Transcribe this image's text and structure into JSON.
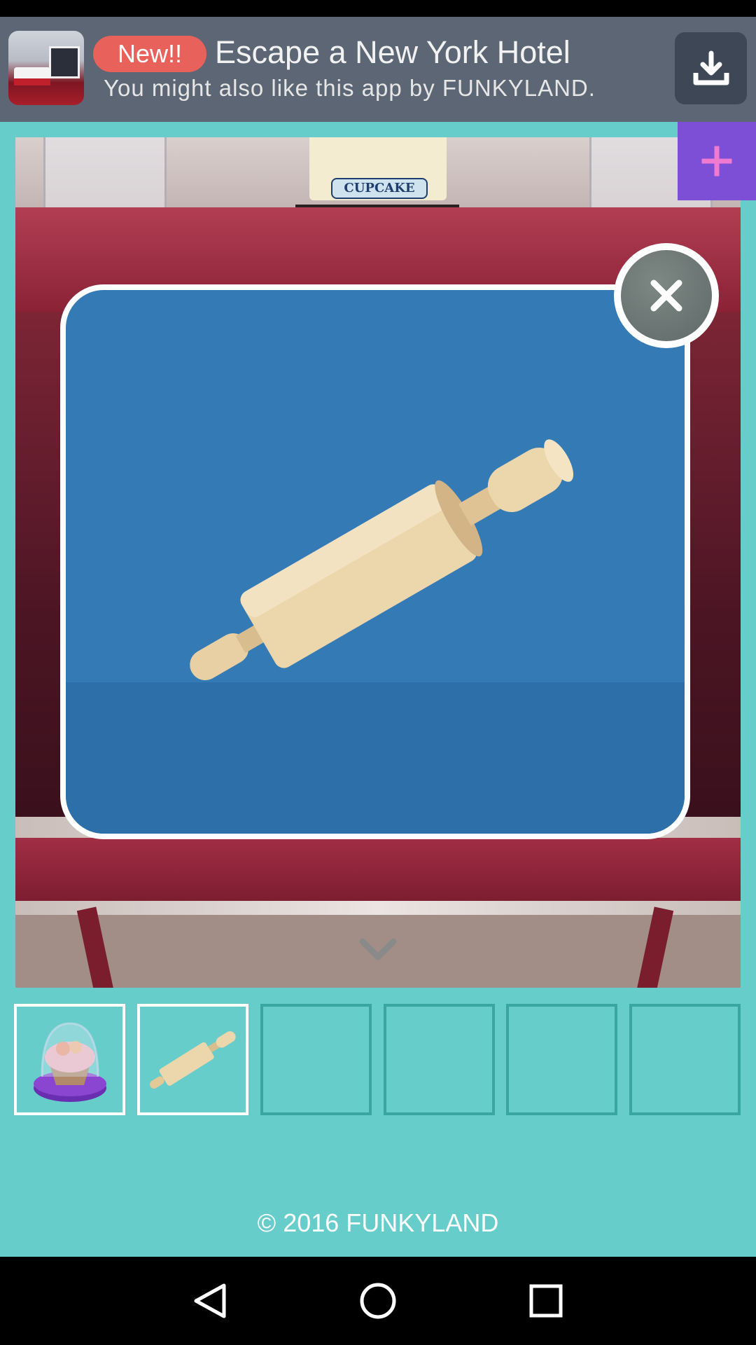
{
  "ad": {
    "badge": "New!!",
    "title": "Escape a New York Hotel",
    "subtitle": "You might also like this app by FUNKYLAND."
  },
  "scene": {
    "sign_label": "CUPCAKE"
  },
  "popup": {
    "item": "rolling-pin"
  },
  "inventory": {
    "slots": [
      "cupcake",
      "rolling-pin",
      "",
      "",
      "",
      ""
    ],
    "selected_index": 1
  },
  "footer": {
    "copyright": "© 2016 FUNKYLAND"
  },
  "colors": {
    "background": "#67cdca",
    "ad_badge": "#e8615a",
    "plus_button": "#7c4fd6",
    "popup": "#347ab5"
  }
}
